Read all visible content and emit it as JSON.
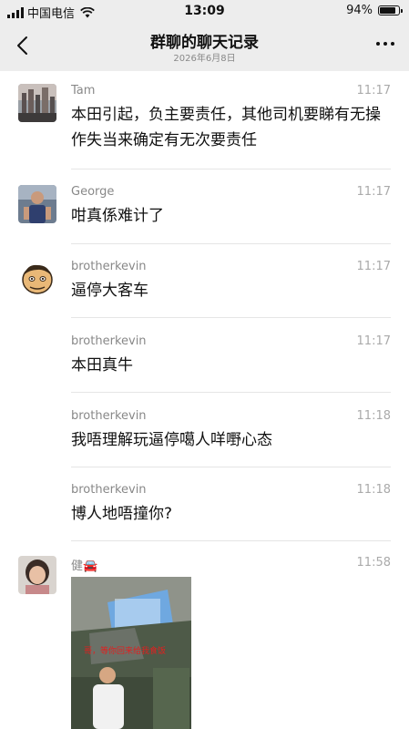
{
  "status_bar": {
    "carrier": "中国电信",
    "time": "13:09",
    "battery": "94%",
    "battery_level": 0.94
  },
  "header": {
    "title": "群聊的聊天记录",
    "subtitle": "2026年6月8日"
  },
  "messages": [
    {
      "sender": "Tam",
      "time": "11:17",
      "text": "本田引起，负主要责任，其他司机要睇有无操作失当来确定有无次要责任"
    },
    {
      "sender": "George",
      "time": "11:17",
      "text": "咁真係难计了"
    },
    {
      "sender": "brotherkevin",
      "time": "11:17",
      "text": "逼停大客车"
    },
    {
      "sender": "brotherkevin",
      "time": "11:17",
      "text": "本田真牛"
    },
    {
      "sender": "brotherkevin",
      "time": "11:18",
      "text": "我唔理解玩逼停噶人咩嘢心态"
    },
    {
      "sender": "brotherkevin",
      "time": "11:18",
      "text": "博人地唔撞你?"
    },
    {
      "sender": "健🚘",
      "time": "11:58",
      "image_caption": "哥，等你回来给我食饭"
    }
  ],
  "icons": {
    "back": "chevron-left-icon",
    "more": "more-dots-icon",
    "wifi": "wifi-icon",
    "signal": "signal-icon",
    "battery": "battery-icon"
  }
}
